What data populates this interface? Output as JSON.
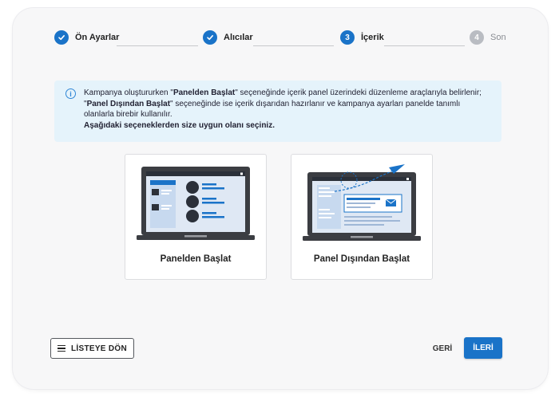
{
  "stepper": {
    "steps": [
      {
        "label": "Ön Ayarlar",
        "state": "done",
        "number": ""
      },
      {
        "label": "Alıcılar",
        "state": "done",
        "number": ""
      },
      {
        "label": "İçerik",
        "state": "active",
        "number": "3"
      },
      {
        "label": "Son",
        "state": "pending",
        "number": "4"
      }
    ]
  },
  "info": {
    "line1_pre": "Kampanya oluştururken \"",
    "line1_bold": "Panelden Başlat",
    "line1_post": "\" seçeneğinde içerik panel üzerindeki düzenleme araçlarıyla belirlenir;",
    "line2_pre": "\"",
    "line2_bold": "Panel Dışından Başlat",
    "line2_post": "\" seçeneğinde ise içerik dışarıdan hazırlanır ve kampanya ayarları panelde tanımlı olanlarla birebir kullanılır.",
    "line3": "Aşağıdaki seçeneklerden size uygun olanı seçiniz."
  },
  "options": [
    {
      "label": "Panelden Başlat"
    },
    {
      "label": "Panel Dışından Başlat"
    }
  ],
  "footer": {
    "list_label": "LİSTEYE DÖN",
    "back_label": "GERİ",
    "next_label": "İLERİ"
  },
  "colors": {
    "primary": "#1a73c8",
    "info_bg": "#e5f3fb",
    "pending": "#b9bcc2"
  }
}
